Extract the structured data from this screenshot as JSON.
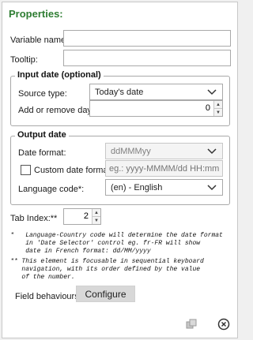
{
  "title": "Properties:",
  "variable_name": {
    "label": "Variable name:",
    "value": ""
  },
  "tooltip": {
    "label": "Tooltip:",
    "value": ""
  },
  "input_date": {
    "group_title": "Input date (optional)",
    "source_type_label": "Source type:",
    "source_type_value": "Today's date",
    "add_remove_label": "Add or remove days:",
    "add_remove_value": "0"
  },
  "output_date": {
    "group_title": "Output date",
    "date_format_label": "Date format:",
    "date_format_value": "ddMMMyy",
    "custom_format_label": "Custom date format:",
    "custom_format_placeholder": "eg.: yyyy-MMMM/dd HH:mm",
    "language_label": "Language code*:",
    "language_value": "(en) - English"
  },
  "tab_index": {
    "label": "Tab Index:**",
    "value": "2"
  },
  "notes": {
    "note1": "*   Language-Country code will determine the date format\n    in 'Date Selector' control eg. fr-FR will show\n    date in French format: dd/MM/yyyy",
    "note2": "** This element is focusable in sequential keyboard\n   navigation, with its order defined by the value\n   of the number."
  },
  "field_behaviours": {
    "label": "Field behaviours:",
    "button": "Configure"
  },
  "icons": {
    "copy": "copy-icon",
    "close": "close-circle-icon"
  },
  "colors": {
    "title": "#2e7d32",
    "border": "#a9a9a9",
    "button": "#d8d8d8"
  }
}
